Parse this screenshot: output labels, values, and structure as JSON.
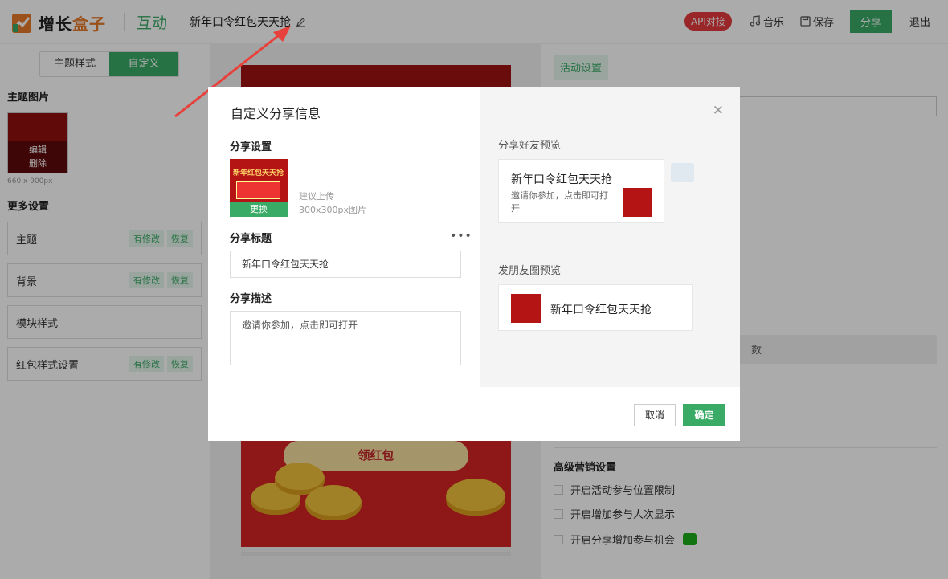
{
  "header": {
    "brand": {
      "part1": "增长",
      "part2": "盒子"
    },
    "product": "互动",
    "activity_title": "新年口令红包天天抢",
    "api_badge": "API对接",
    "music": "音乐",
    "save": "保存",
    "share": "分享",
    "exit": "退出"
  },
  "left_panel": {
    "tabs": [
      "主题样式",
      "自定义"
    ],
    "theme_image_label": "主题图片",
    "thumb_edit": "编辑",
    "thumb_delete": "删除",
    "thumb_size": "660 x 900px",
    "more_settings_label": "更多设置",
    "rows": [
      {
        "label": "主题",
        "modified": "有修改",
        "restore": "恢复"
      },
      {
        "label": "背景",
        "modified": "有修改",
        "restore": "恢复"
      },
      {
        "label": "模块样式"
      },
      {
        "label": "红包样式设置",
        "modified": "有修改",
        "restore": "恢复"
      }
    ]
  },
  "preview": {
    "claim_button": "领红包"
  },
  "right_panel": {
    "tab": "活动设置",
    "bar_text": "数",
    "advanced_title": "高级营销设置",
    "options": [
      "开启活动参与位置限制",
      "开启增加参与人次显示",
      "开启分享增加参与机会"
    ]
  },
  "modal": {
    "title": "自定义分享信息",
    "share_settings_label": "分享设置",
    "share_image_title": "新年红包天天抢",
    "change_label": "更换",
    "upload_hint": "建议上传300x300px图片",
    "share_title_label": "分享标题",
    "share_title_value": "新年口令红包天天抢",
    "share_desc_label": "分享描述",
    "share_desc_value": "邀请你参加，点击即可打开",
    "friend_preview_label": "分享好友预览",
    "friend_card_title": "新年口令红包天天抢",
    "friend_card_desc": "邀请你参加，点击即可打开",
    "moments_preview_label": "发朋友圈预览",
    "moments_card_title": "新年口令红包天天抢",
    "cancel": "取消",
    "confirm": "确定"
  },
  "colors": {
    "accent": "#3aab66",
    "red": "#e4393c"
  }
}
